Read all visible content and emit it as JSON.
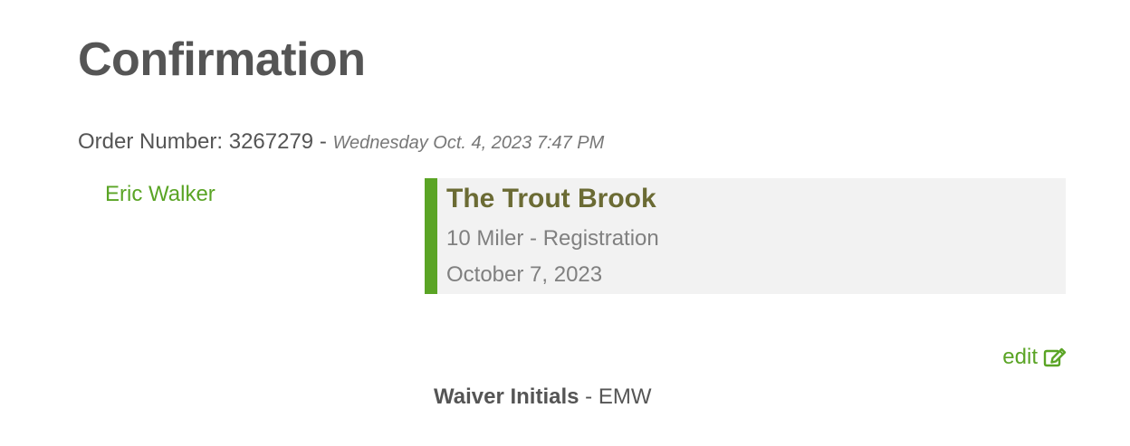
{
  "page": {
    "title": "Confirmation"
  },
  "order": {
    "label": "Order Number:",
    "number": "3267279",
    "separator": "-",
    "datetime": "Wednesday Oct. 4, 2023 7:47 PM"
  },
  "participant": {
    "name": "Eric Walker"
  },
  "event": {
    "name": "The Trout Brook",
    "registration": "10 Miler - Registration",
    "date": "October 7, 2023"
  },
  "actions": {
    "edit_label": "edit",
    "edit_icon": "edit-square-icon"
  },
  "waiver": {
    "label": "Waiver Initials",
    "separator": "-",
    "value": "EMW"
  },
  "colors": {
    "accent_green": "#5aa425",
    "event_title": "#6b6b34",
    "card_background": "#f2f2f2"
  }
}
